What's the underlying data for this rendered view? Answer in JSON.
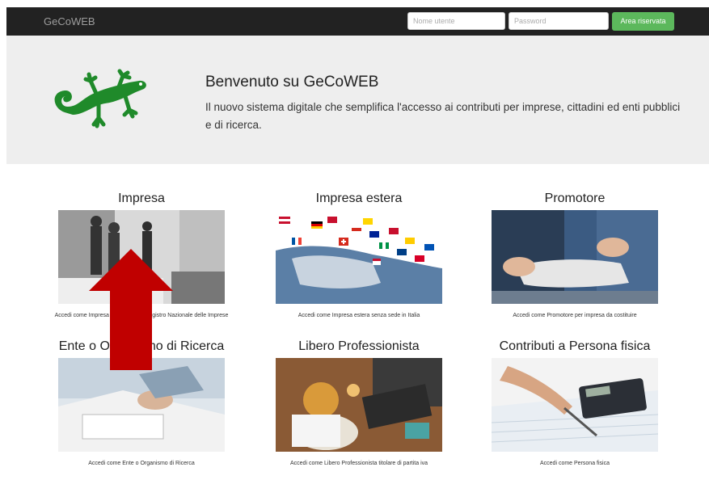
{
  "navbar": {
    "brand": "GeCoWEB",
    "username_placeholder": "Nome utente",
    "password_placeholder": "Password",
    "login_label": "Area riservata"
  },
  "hero": {
    "title": "Benvenuto su GeCoWEB",
    "text": "Il nuovo sistema digitale che semplifica l'accesso ai contributi per imprese, cittadini ed enti pubblici e di ricerca."
  },
  "cards": [
    {
      "title": "Impresa",
      "caption": "Accedi come Impresa registrata nel Registro Nazionale delle Imprese"
    },
    {
      "title": "Impresa estera",
      "caption": "Accedi come Impresa estera senza sede in Italia"
    },
    {
      "title": "Promotore",
      "caption": "Accedi come Promotore per impresa da costituire"
    },
    {
      "title": "Ente o Organismo di Ricerca",
      "caption": "Accedi come Ente o Organismo di Ricerca"
    },
    {
      "title": "Libero Professionista",
      "caption": "Accedi come Libero Professionista titolare di partita iva"
    },
    {
      "title": "Contributi a Persona fisica",
      "caption": "Accedi come Persona fisica"
    }
  ],
  "colors": {
    "navbar": "#222222",
    "login_button": "#5cb85c",
    "hero_bg": "#eeeeee",
    "arrow": "#c00000",
    "logo": "#1f8a2a"
  }
}
